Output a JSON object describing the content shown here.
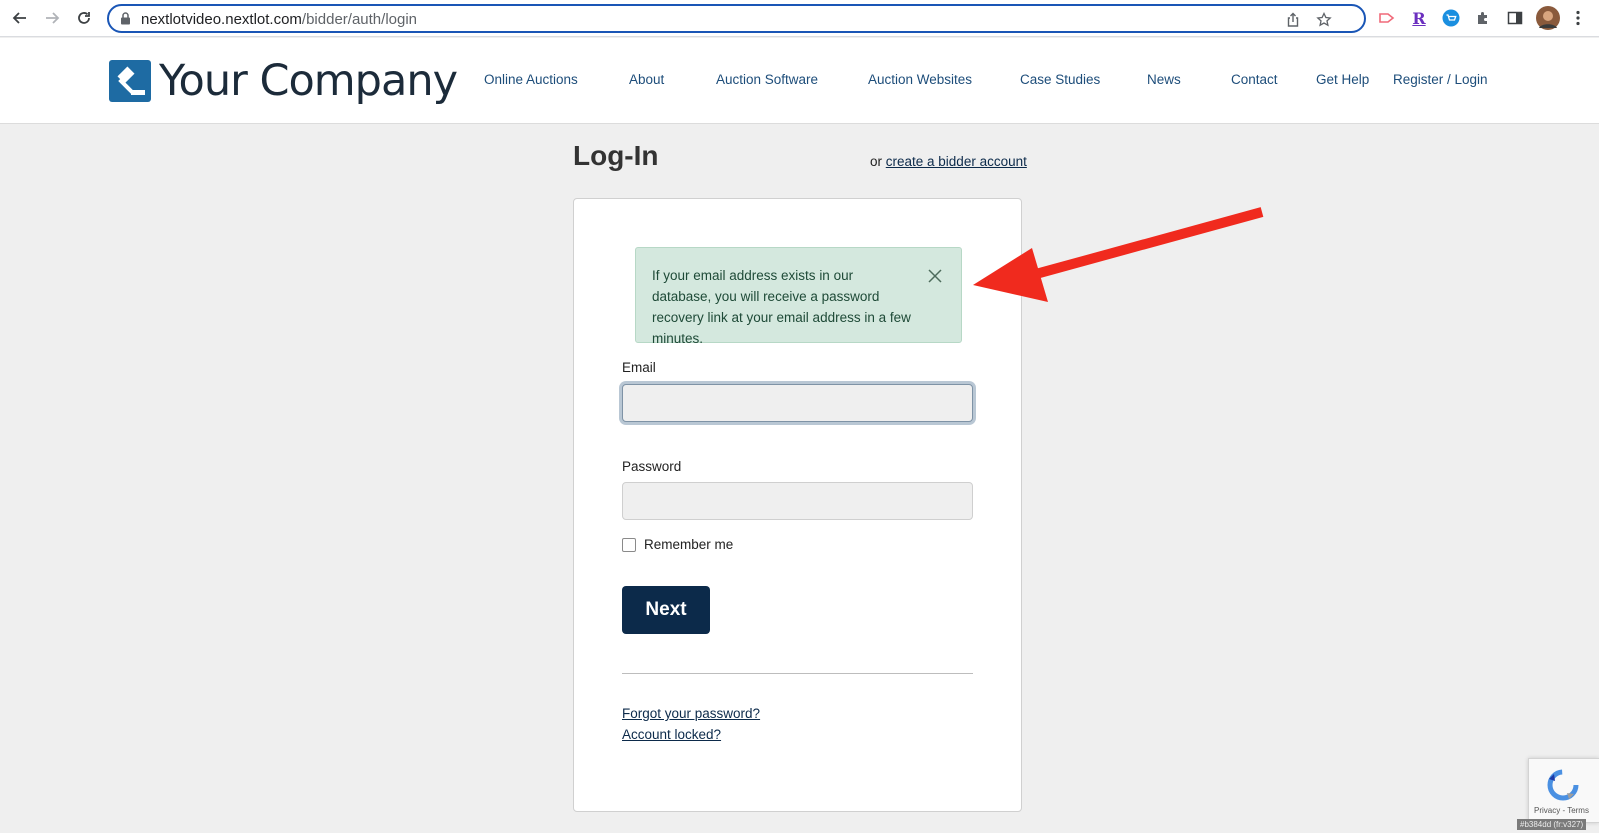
{
  "browser": {
    "url_host": "nextlotvideo.nextlot.com",
    "url_path": "/bidder/auth/login"
  },
  "header": {
    "logo_text": "Your Company",
    "nav": [
      {
        "label": "Online Auctions"
      },
      {
        "label": "About"
      },
      {
        "label": "Auction Software"
      },
      {
        "label": "Auction Websites"
      },
      {
        "label": "Case Studies"
      },
      {
        "label": "News"
      },
      {
        "label": "Contact"
      },
      {
        "label": "Get Help"
      },
      {
        "label": "Register / Login"
      }
    ]
  },
  "login": {
    "title": "Log-In",
    "or_text": "or ",
    "create_account_link": "create a bidder account",
    "alert_text": "If your email address exists in our database, you will receive a password recovery link at your email address in a few minutes.",
    "email_label": "Email",
    "email_value": "",
    "password_label": "Password",
    "password_value": "",
    "remember_label": "Remember me",
    "remember_checked": false,
    "next_label": "Next",
    "forgot_link": "Forgot your password?",
    "locked_link": "Account locked?"
  },
  "recaptcha": {
    "text": "Privacy - Terms"
  },
  "version_tag": "#b384dd (fr:v327)",
  "colors": {
    "accent_dark": "#0c2a4a",
    "nav_link": "#1d4d7a",
    "alert_bg": "#d4e8de",
    "annotation_arrow": "#f02a1e"
  }
}
